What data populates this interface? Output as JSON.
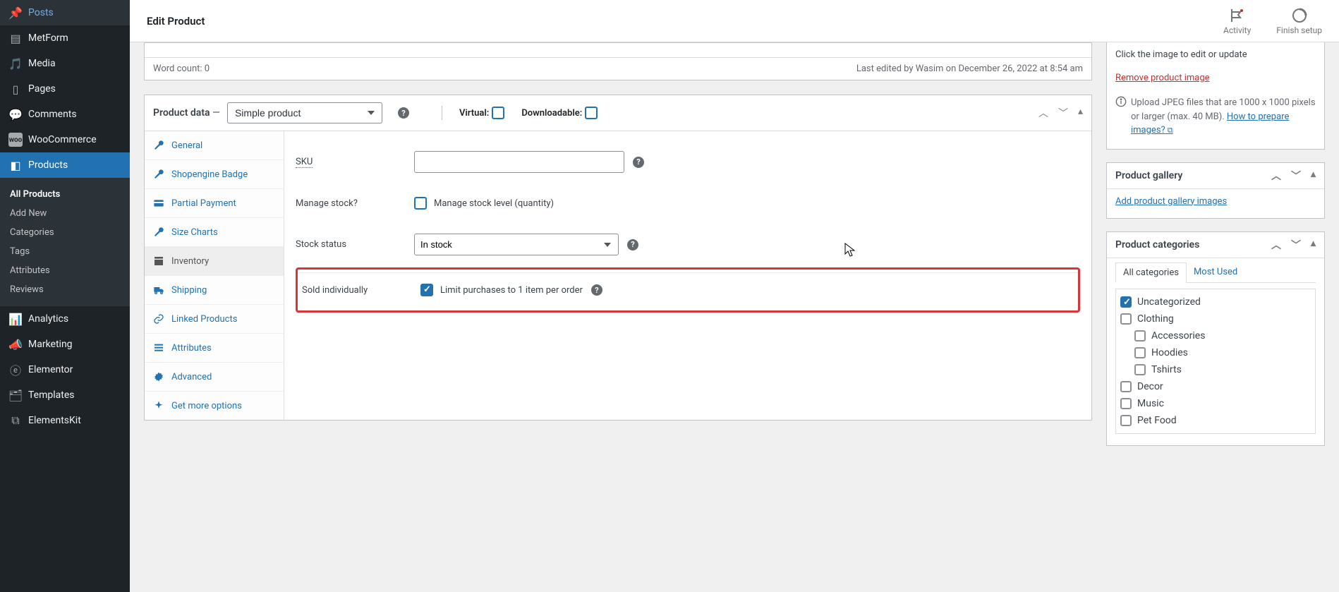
{
  "header": {
    "title": "Edit Product",
    "activity": "Activity",
    "finish": "Finish setup"
  },
  "sidebar": {
    "items": [
      {
        "label": "Posts"
      },
      {
        "label": "MetForm"
      },
      {
        "label": "Media"
      },
      {
        "label": "Pages"
      },
      {
        "label": "Comments"
      },
      {
        "label": "WooCommerce"
      },
      {
        "label": "Products"
      },
      {
        "label": "Analytics"
      },
      {
        "label": "Marketing"
      },
      {
        "label": "Elementor"
      },
      {
        "label": "Templates"
      },
      {
        "label": "ElementsKit"
      }
    ],
    "submenu": [
      {
        "label": "All Products"
      },
      {
        "label": "Add New"
      },
      {
        "label": "Categories"
      },
      {
        "label": "Tags"
      },
      {
        "label": "Attributes"
      },
      {
        "label": "Reviews"
      }
    ]
  },
  "editor": {
    "word_count": "Word count: 0",
    "last_edited": "Last edited by Wasim on December 26, 2022 at 8:54 am"
  },
  "product_data": {
    "title": "Product data",
    "dash": " —",
    "type_selected": "Simple product",
    "virtual_label": "Virtual:",
    "downloadable_label": "Downloadable:",
    "tabs": [
      {
        "label": "General"
      },
      {
        "label": "Shopengine Badge"
      },
      {
        "label": "Partial Payment"
      },
      {
        "label": "Size Charts"
      },
      {
        "label": "Inventory"
      },
      {
        "label": "Shipping"
      },
      {
        "label": "Linked Products"
      },
      {
        "label": "Attributes"
      },
      {
        "label": "Advanced"
      },
      {
        "label": "Get more options"
      }
    ],
    "fields": {
      "sku": "SKU",
      "manage_stock": "Manage stock?",
      "manage_stock_label": "Manage stock level (quantity)",
      "stock_status": "Stock status",
      "stock_status_value": "In stock",
      "sold_individually": "Sold individually",
      "sold_individually_label": "Limit purchases to 1 item per order"
    }
  },
  "image_panel": {
    "click_text": "Click the image to edit or update",
    "remove": "Remove product image",
    "upload_note": "Upload JPEG files that are 1000 x 1000 pixels or larger (max. 40 MB). ",
    "how_to": "How to prepare images?"
  },
  "gallery_panel": {
    "title": "Product gallery",
    "link": "Add product gallery images"
  },
  "categories_panel": {
    "title": "Product categories",
    "tab_all": "All categories",
    "tab_most": "Most Used",
    "items": [
      {
        "label": "Uncategorized",
        "checked": true,
        "indent": 0
      },
      {
        "label": "Clothing",
        "checked": false,
        "indent": 0
      },
      {
        "label": "Accessories",
        "checked": false,
        "indent": 1
      },
      {
        "label": "Hoodies",
        "checked": false,
        "indent": 1
      },
      {
        "label": "Tshirts",
        "checked": false,
        "indent": 1
      },
      {
        "label": "Decor",
        "checked": false,
        "indent": 0
      },
      {
        "label": "Music",
        "checked": false,
        "indent": 0
      },
      {
        "label": "Pet Food",
        "checked": false,
        "indent": 0
      }
    ]
  }
}
